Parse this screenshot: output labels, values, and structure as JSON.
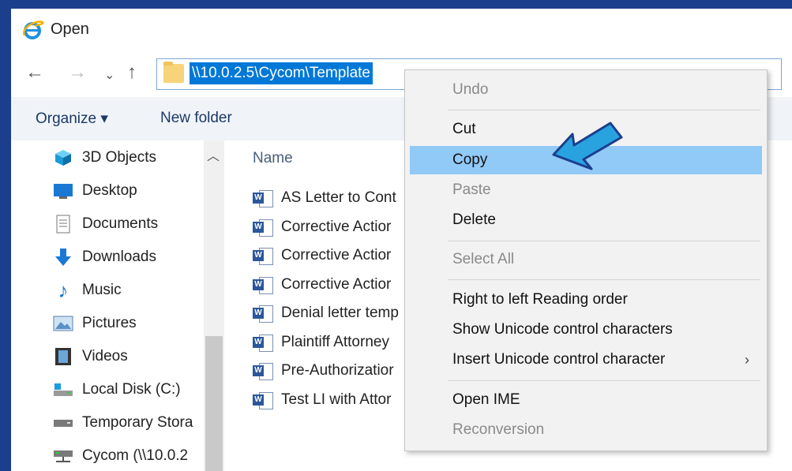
{
  "window": {
    "title": "Open"
  },
  "address": {
    "path": "\\\\10.0.2.5\\Cycom\\Template"
  },
  "nav": {
    "back": "←",
    "forward": "→",
    "recent": "⌄",
    "up": "↑"
  },
  "toolbar": {
    "organize": "Organize ▾",
    "new_folder": "New folder"
  },
  "sidebar": {
    "items": [
      {
        "label": "3D Objects",
        "icon": "3d-objects-icon"
      },
      {
        "label": "Desktop",
        "icon": "desktop-icon"
      },
      {
        "label": "Documents",
        "icon": "documents-icon"
      },
      {
        "label": "Downloads",
        "icon": "downloads-icon"
      },
      {
        "label": "Music",
        "icon": "music-icon"
      },
      {
        "label": "Pictures",
        "icon": "pictures-icon"
      },
      {
        "label": "Videos",
        "icon": "videos-icon"
      },
      {
        "label": "Local Disk (C:)",
        "icon": "local-disk-icon"
      },
      {
        "label": "Temporary Stora",
        "icon": "drive-icon"
      },
      {
        "label": "Cycom (\\\\10.0.2",
        "icon": "network-drive-icon"
      }
    ]
  },
  "files": {
    "column_name": "Name",
    "items": [
      "AS Letter to Cont",
      "Corrective Actior",
      "Corrective Actior",
      "Corrective Actior",
      "Denial letter temp",
      "Plaintiff Attorney",
      "Pre-Authorizatior",
      "Test LI with Attor"
    ]
  },
  "context_menu": {
    "items": [
      {
        "label": "Undo",
        "disabled": true
      },
      {
        "label": "Cut",
        "disabled": false
      },
      {
        "label": "Copy",
        "disabled": false,
        "highlighted": true
      },
      {
        "label": "Paste",
        "disabled": true
      },
      {
        "label": "Delete",
        "disabled": false
      },
      {
        "label": "Select All",
        "disabled": true
      },
      {
        "label": "Right to left Reading order",
        "disabled": false
      },
      {
        "label": "Show Unicode control characters",
        "disabled": false
      },
      {
        "label": "Insert Unicode control character",
        "disabled": false,
        "submenu": true
      },
      {
        "label": "Open IME",
        "disabled": false
      },
      {
        "label": "Reconversion",
        "disabled": true
      }
    ]
  },
  "colors": {
    "frame": "#1b3f8c",
    "selection": "#0078d7",
    "highlight": "#91c9f7",
    "callout": "#29a3e0"
  }
}
